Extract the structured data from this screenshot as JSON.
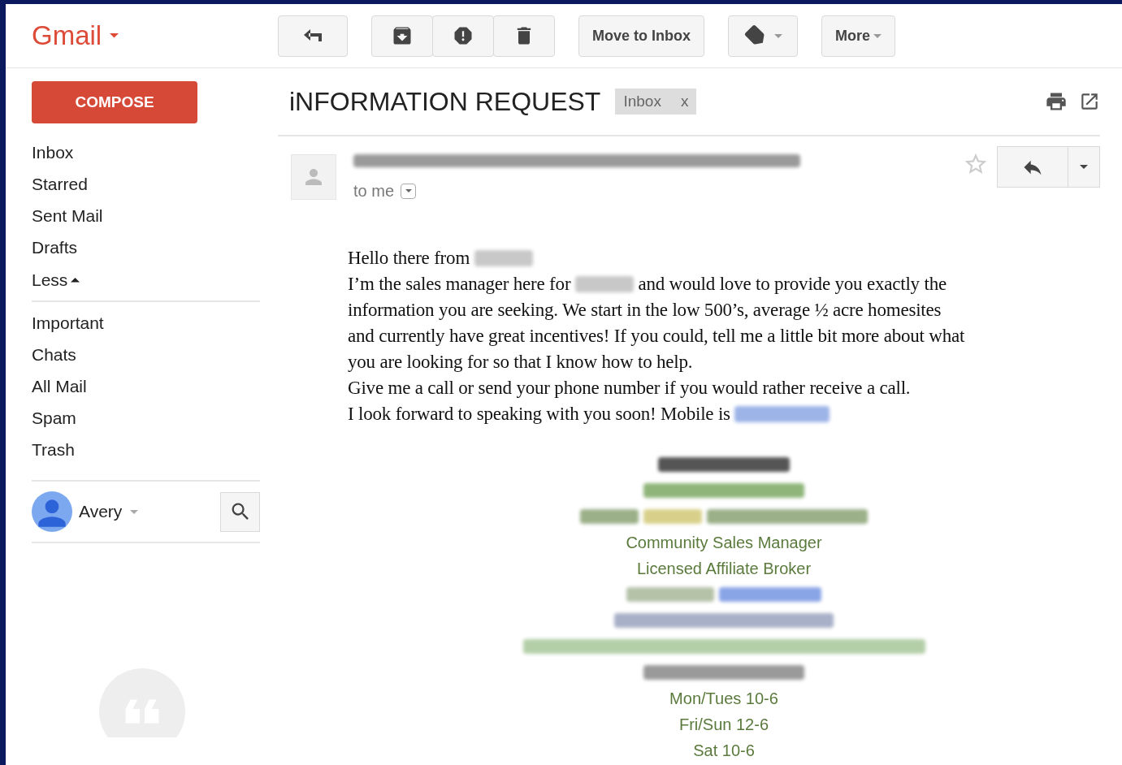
{
  "app": {
    "logo": "Gmail"
  },
  "toolbar": {
    "buttons": [
      {
        "kind": "back"
      },
      {
        "kind": "group",
        "buttons": [
          {
            "kind": "archive"
          },
          {
            "kind": "spam"
          },
          {
            "kind": "delete"
          }
        ]
      },
      {
        "kind": "text",
        "label": "Move to Inbox"
      },
      {
        "kind": "labels"
      },
      {
        "kind": "menu",
        "label": "More"
      }
    ]
  },
  "sidebar": {
    "compose": "COMPOSE",
    "items": [
      {
        "label": "Inbox"
      },
      {
        "label": "Starred"
      },
      {
        "label": "Sent Mail"
      },
      {
        "label": "Drafts"
      }
    ],
    "toggle": {
      "label": "Less",
      "expanded": true
    },
    "more_items": [
      {
        "label": "Important"
      },
      {
        "label": "Chats"
      },
      {
        "label": "All Mail"
      },
      {
        "label": "Spam"
      },
      {
        "label": "Trash"
      }
    ],
    "account": {
      "name": "Avery"
    }
  },
  "message": {
    "subject": "iNFORMATION REQUEST",
    "label_chip": {
      "text": "Inbox",
      "close": "x"
    },
    "starred": false,
    "recipient": "to me",
    "body": [
      [
        {
          "kind": "text",
          "text": "Hello there from "
        },
        {
          "kind": "blur",
          "color": "#c8c8c8"
        }
      ],
      [
        {
          "kind": "text",
          "text": "I’m the sales manager here for "
        },
        {
          "kind": "blur",
          "color": "#c8c8c8"
        },
        {
          "kind": "text",
          "text": " and would love to provide you exactly the"
        }
      ],
      [
        {
          "kind": "text",
          "text": "information you are seeking. We start in the low 500’s, average ½ acre homesites"
        }
      ],
      [
        {
          "kind": "text",
          "text": "and currently have great incentives! If you could, tell me a little bit more about what"
        }
      ],
      [
        {
          "kind": "text",
          "text": "you are looking for so that I know how to help."
        }
      ],
      [
        {
          "kind": "text",
          "text": "Give me a call or send your phone number if you would rather receive a call."
        }
      ],
      [
        {
          "kind": "text",
          "text": "I look forward to speaking with you soon! Mobile is "
        },
        {
          "kind": "blur",
          "color": "#9db4e8"
        }
      ]
    ],
    "signature": [
      [
        {
          "kind": "blur",
          "color": "#555555"
        }
      ],
      [
        {
          "kind": "blur",
          "color": "#8fb57a"
        }
      ],
      [
        {
          "kind": "blur",
          "color": "#9bb088"
        },
        {
          "kind": "blur",
          "color": "#d8d08a"
        },
        {
          "kind": "blur",
          "color": "#9bb088"
        }
      ],
      [
        {
          "kind": "text",
          "text": "Community Sales Manager"
        }
      ],
      [
        {
          "kind": "text",
          "text": "Licensed Affiliate Broker"
        }
      ],
      [
        {
          "kind": "blur",
          "color": "#b5c2a8"
        },
        {
          "kind": "blur",
          "color": "#8aa5e6"
        }
      ],
      [
        {
          "kind": "blur",
          "color": "#a8b0c8"
        }
      ],
      [
        {
          "kind": "blur",
          "color": "#b3cfa8"
        }
      ],
      [
        {
          "kind": "blur",
          "color": "#9a9a9a"
        }
      ],
      [
        {
          "kind": "text",
          "text": "Mon/Tues 10-6"
        }
      ],
      [
        {
          "kind": "text",
          "text": "Fri/Sun 12-6"
        }
      ],
      [
        {
          "kind": "text",
          "text": "Sat 10-6"
        }
      ]
    ]
  }
}
